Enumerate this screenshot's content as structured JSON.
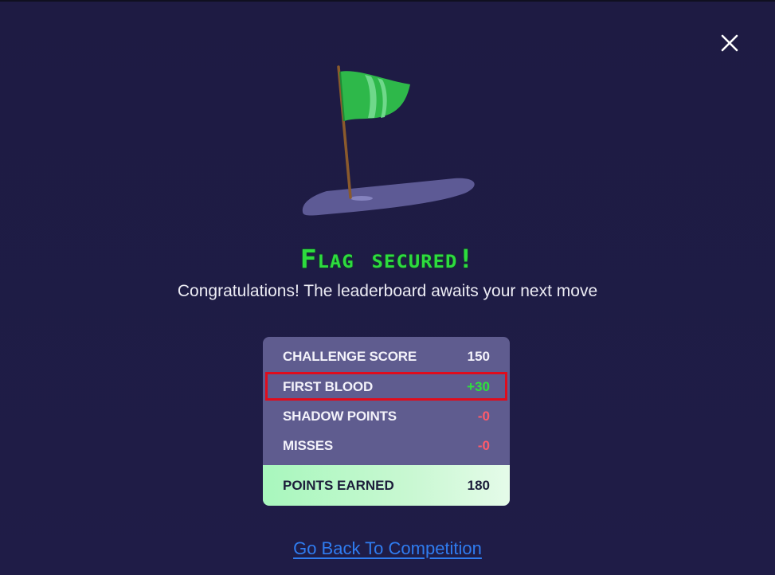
{
  "dialog": {
    "title": "Flag secured!",
    "subtitle": "Congratulations! The leaderboard awaits your next move",
    "close_icon": "close-icon",
    "illustration_icon": "flag-on-green-icon"
  },
  "score_card": {
    "rows": [
      {
        "label": "CHALLENGE SCORE",
        "value": "150"
      },
      {
        "label": "FIRST BLOOD",
        "value": "+30"
      },
      {
        "label": "SHADOW POINTS",
        "value": "-0"
      },
      {
        "label": "MISSES",
        "value": "-0"
      }
    ],
    "total": {
      "label": "POINTS EARNED",
      "value": "180"
    }
  },
  "footer": {
    "back_link": "Go Back To Competition"
  },
  "colors": {
    "background": "#1e1b43",
    "title_green": "#2ddc3e",
    "card_bg": "#5f5c8f",
    "highlight_red": "#e00c1c",
    "negative_red": "#ff5a6a",
    "link_blue": "#2f7cf0",
    "total_bg": "#c9f8d2"
  }
}
